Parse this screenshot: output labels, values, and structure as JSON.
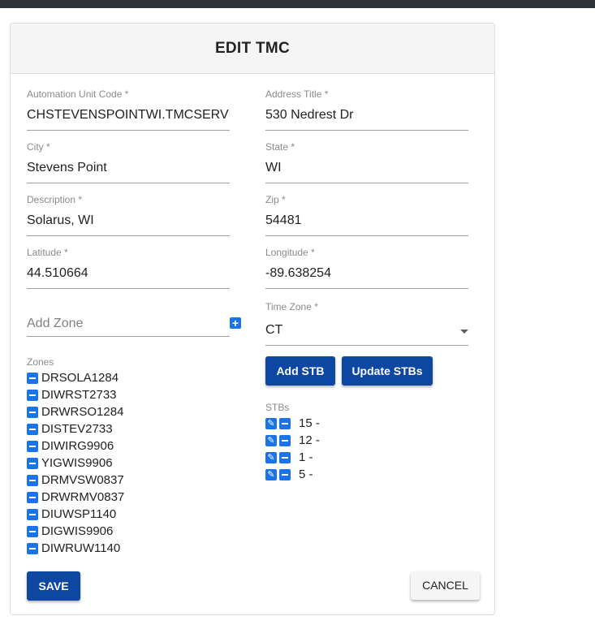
{
  "dialog": {
    "title": "EDIT TMC"
  },
  "fields": {
    "automation_unit_code": {
      "label": "Automation Unit Code *",
      "value": "CHSTEVENSPOINTWI.TMCSERVER"
    },
    "address_title": {
      "label": "Address Title *",
      "value": "530 Nedrest Dr"
    },
    "city": {
      "label": "City *",
      "value": "Stevens Point"
    },
    "state": {
      "label": "State *",
      "value": "WI"
    },
    "description": {
      "label": "Description *",
      "value": "Solarus, WI"
    },
    "zip": {
      "label": "Zip *",
      "value": "54481"
    },
    "latitude": {
      "label": "Latitude *",
      "value": "44.510664"
    },
    "longitude": {
      "label": "Longitude *",
      "value": "-89.638254"
    },
    "time_zone": {
      "label": "Time Zone *",
      "value": "CT"
    }
  },
  "add_zone": {
    "placeholder": "Add Zone"
  },
  "zones": {
    "label": "Zones",
    "items": [
      "DRSOLA1284",
      "DIWRST2733",
      "DRWRSO1284",
      "DISTEV2733",
      "DIWIRG9906",
      "YIGWIS9906",
      "DRMVSW0837",
      "DRWRMV0837",
      "DIUWSP1140",
      "DIGWIS9906",
      "DIWRUW1140"
    ]
  },
  "buttons": {
    "add_stb": "Add STB",
    "update_stbs": "Update STBs",
    "save": "SAVE",
    "cancel": "CANCEL"
  },
  "stbs": {
    "label": "STBs",
    "items": [
      "15 -",
      "12 -",
      "1 -",
      "5 -"
    ]
  },
  "colors": {
    "primary_button": "#0d47a1",
    "icon_blue": "#1a73e8",
    "top_bar": "#2e3338"
  }
}
